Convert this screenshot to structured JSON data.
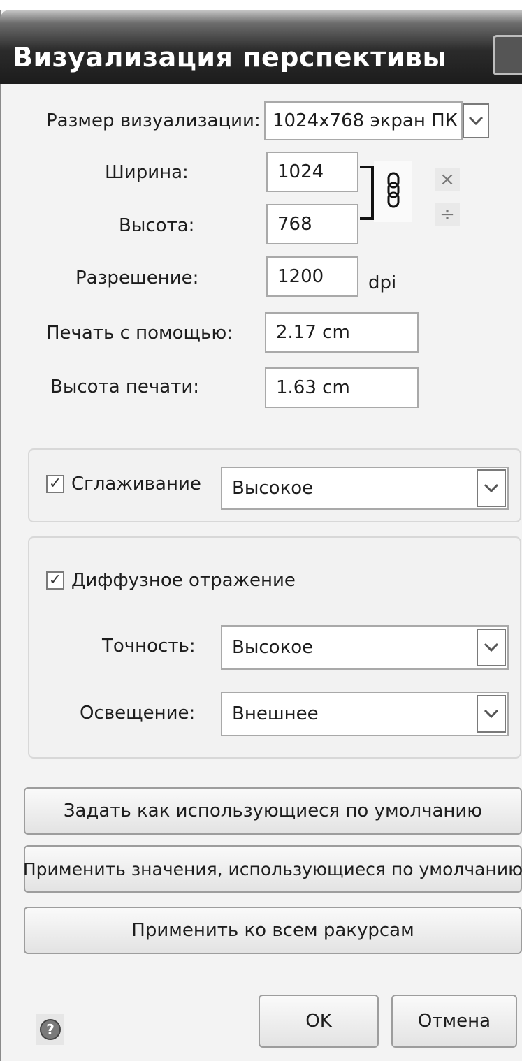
{
  "dialog": {
    "title": "Визуализация перспективы"
  },
  "size": {
    "label": "Размер визуализации:",
    "value": "1024x768 экран ПК"
  },
  "width": {
    "label": "Ширина:",
    "value": "1024"
  },
  "height": {
    "label": "Высота:",
    "value": "768"
  },
  "resolution": {
    "label": "Разрешение:",
    "value": "1200",
    "unit": "dpi"
  },
  "print_width": {
    "label": "Печать с помощью:",
    "value": "2.17 cm"
  },
  "print_height": {
    "label": "Высота печати:",
    "value": "1.63 cm"
  },
  "icons": {
    "chain": "chain-link-icon",
    "multiply": "×",
    "divide": "÷",
    "help": "?",
    "checkmark": "✓"
  },
  "antialiasing": {
    "label": "Сглаживание",
    "checked": true,
    "value": "Высокое"
  },
  "diffuse": {
    "label": "Диффузное отражение",
    "checked": true,
    "accuracy_label": "Точность:",
    "accuracy_value": "Высокое",
    "lighting_label": "Освещение:",
    "lighting_value": "Внешнее"
  },
  "buttons": {
    "set_default": "Задать как использующиеся по умолчанию",
    "apply_default": "Применить значения, использующиеся по умолчанию",
    "apply_all": "Применить ко всем ракурсам",
    "ok": "OK",
    "cancel": "Отмена"
  }
}
